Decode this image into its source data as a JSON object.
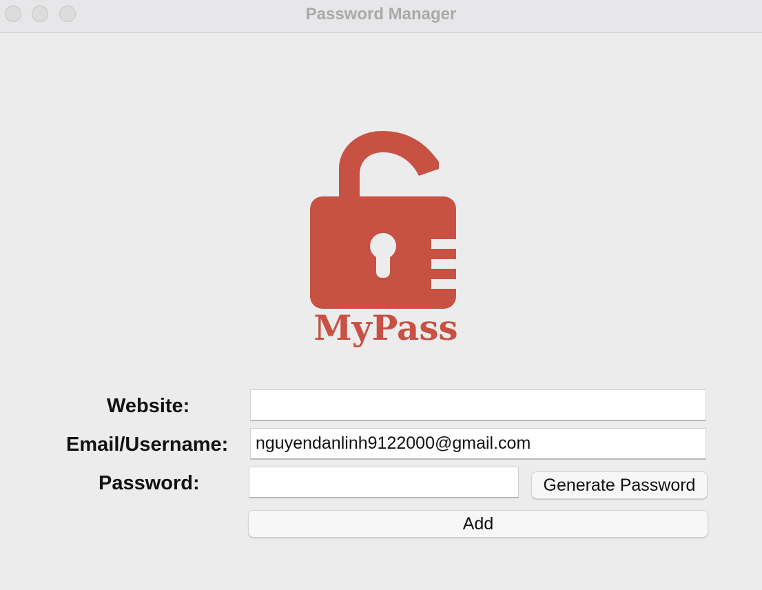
{
  "window": {
    "title": "Password Manager",
    "controls": [
      "close-icon",
      "minimize-icon",
      "zoom-icon"
    ]
  },
  "logo": {
    "text": "MyPass",
    "icon": "open-padlock-icon",
    "color": "#c75143"
  },
  "form": {
    "website_label": "Website:",
    "website_value": "",
    "email_label": "Email/Username:",
    "email_value": "nguyendanlinh9122000@gmail.com",
    "password_label": "Password:",
    "password_value": "",
    "generate_button_label": "Generate Password",
    "add_button_label": "Add"
  }
}
